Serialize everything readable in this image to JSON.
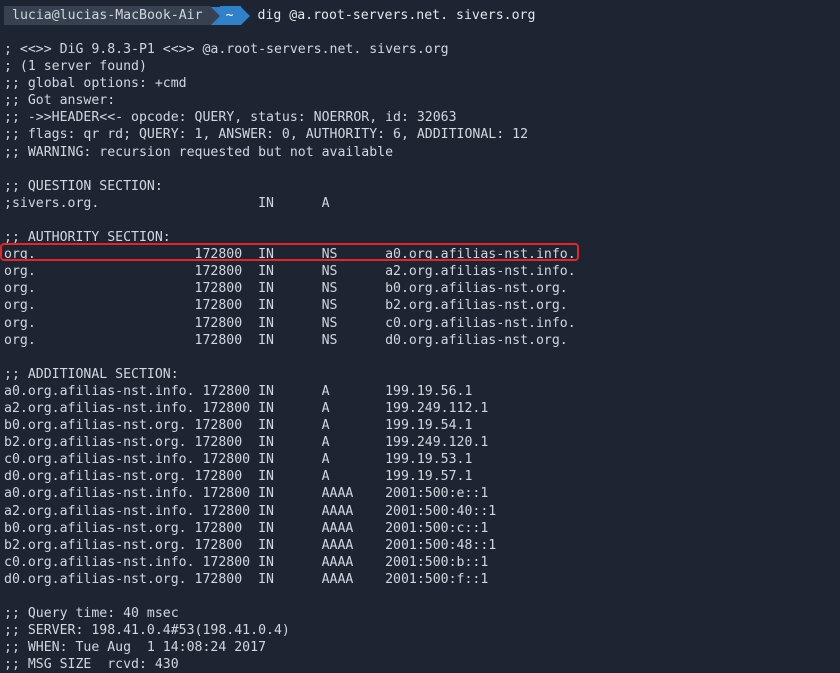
{
  "prompt": {
    "user_host": "lucia@lucias-MacBook-Air",
    "directory": "~",
    "command": "dig @a.root-servers.net. sivers.org"
  },
  "output_lines": [
    "; <<>> DiG 9.8.3-P1 <<>> @a.root-servers.net. sivers.org",
    "; (1 server found)",
    ";; global options: +cmd",
    ";; Got answer:",
    ";; ->>HEADER<<- opcode: QUERY, status: NOERROR, id: 32063",
    ";; flags: qr rd; QUERY: 1, ANSWER: 0, AUTHORITY: 6, ADDITIONAL: 12",
    ";; WARNING: recursion requested but not available",
    "",
    ";; QUESTION SECTION:",
    ";sivers.org.                    IN      A",
    "",
    ";; AUTHORITY SECTION:",
    "org.                    172800  IN      NS      a0.org.afilias-nst.info.",
    "org.                    172800  IN      NS      a2.org.afilias-nst.info.",
    "org.                    172800  IN      NS      b0.org.afilias-nst.org.",
    "org.                    172800  IN      NS      b2.org.afilias-nst.org.",
    "org.                    172800  IN      NS      c0.org.afilias-nst.info.",
    "org.                    172800  IN      NS      d0.org.afilias-nst.org.",
    "",
    ";; ADDITIONAL SECTION:",
    "a0.org.afilias-nst.info. 172800 IN      A       199.19.56.1",
    "a2.org.afilias-nst.info. 172800 IN      A       199.249.112.1",
    "b0.org.afilias-nst.org. 172800  IN      A       199.19.54.1",
    "b2.org.afilias-nst.org. 172800  IN      A       199.249.120.1",
    "c0.org.afilias-nst.info. 172800 IN      A       199.19.53.1",
    "d0.org.afilias-nst.org. 172800  IN      A       199.19.57.1",
    "a0.org.afilias-nst.info. 172800 IN      AAAA    2001:500:e::1",
    "a2.org.afilias-nst.info. 172800 IN      AAAA    2001:500:40::1",
    "b0.org.afilias-nst.org. 172800  IN      AAAA    2001:500:c::1",
    "b2.org.afilias-nst.org. 172800  IN      AAAA    2001:500:48::1",
    "c0.org.afilias-nst.info. 172800 IN      AAAA    2001:500:b::1",
    "d0.org.afilias-nst.org. 172800  IN      AAAA    2001:500:f::1",
    "",
    ";; Query time: 40 msec",
    ";; SERVER: 198.41.0.4#53(198.41.0.4)",
    ";; WHEN: Tue Aug  1 14:08:24 2017",
    ";; MSG SIZE  rcvd: 430"
  ],
  "colors": {
    "background": "#1d2532",
    "text": "#d2d7df",
    "prompt_user_bg": "#38414f",
    "prompt_dir_bg": "#2f81c9",
    "highlight_border": "#e5252a"
  }
}
